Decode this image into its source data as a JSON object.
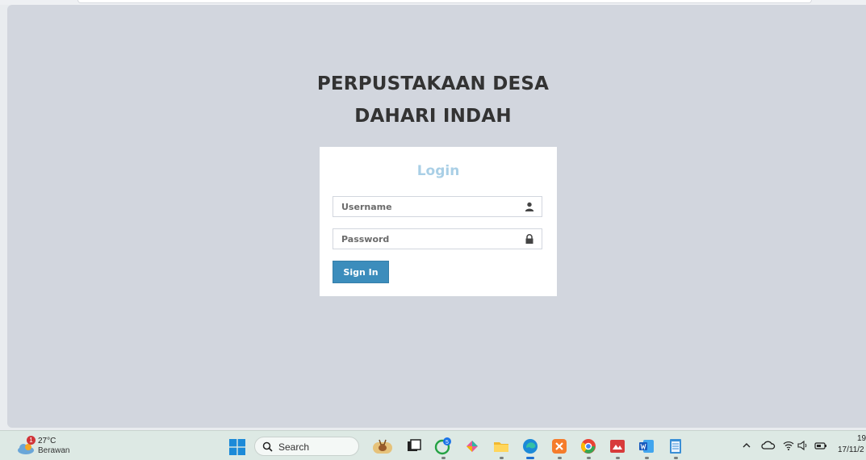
{
  "page": {
    "title_line1": "PERPUSTAKAAN DESA",
    "title_line2": "DAHARI INDAH"
  },
  "login": {
    "heading": "Login",
    "username_placeholder": "Username",
    "password_placeholder": "Password",
    "submit_label": "Sign In"
  },
  "taskbar": {
    "weather_temp": "27°C",
    "weather_condition": "Berawan",
    "weather_badge": "1",
    "search_label": "Search",
    "whatsapp_badge": "5",
    "clock_time": "19",
    "clock_date": "17/11/2"
  },
  "colors": {
    "page_bg": "#d2d6de",
    "login_heading": "#a9cfe6",
    "button": "#3c8dbc"
  }
}
